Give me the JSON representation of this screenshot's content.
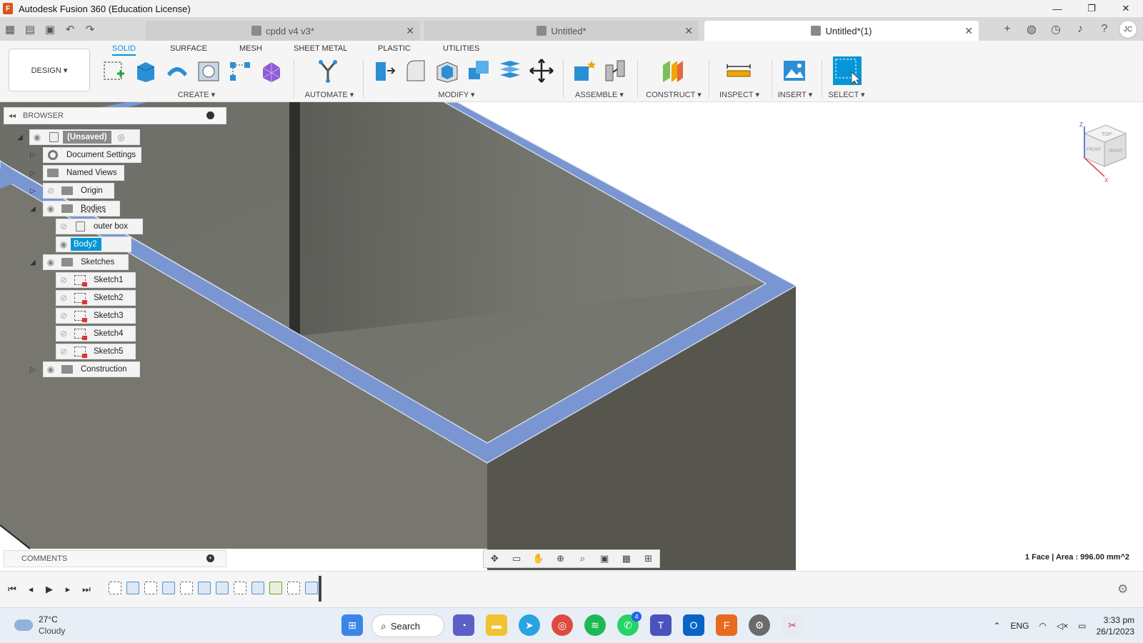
{
  "window": {
    "title": "Autodesk Fusion 360 (Education License)",
    "minimize": "—",
    "maximize": "❐",
    "close": "✕"
  },
  "tabs": [
    {
      "label": "cpdd v4 v3*",
      "active": false
    },
    {
      "label": "Untitled*",
      "active": false
    },
    {
      "label": "Untitled*(1)",
      "active": true
    }
  ],
  "user_initials": "JC",
  "workspace": {
    "design_label": "DESIGN ▾",
    "tabs": [
      "SOLID",
      "SURFACE",
      "MESH",
      "SHEET METAL",
      "PLASTIC",
      "UTILITIES"
    ],
    "active_tab": "SOLID"
  },
  "ribbon_groups": {
    "create": "CREATE ▾",
    "automate": "AUTOMATE ▾",
    "modify": "MODIFY ▾",
    "assemble": "ASSEMBLE ▾",
    "construct": "CONSTRUCT ▾",
    "inspect": "INSPECT ▾",
    "insert": "INSERT ▾",
    "select": "SELECT ▾"
  },
  "browser": {
    "title": "BROWSER",
    "root": "(Unsaved)",
    "items": {
      "document_settings": "Document Settings",
      "named_views": "Named Views",
      "origin": "Origin",
      "bodies": "Bodies",
      "outer_box": "outer box",
      "body2": "Body2",
      "sketches": "Sketches",
      "sketch1": "Sketch1",
      "sketch2": "Sketch2",
      "sketch3": "Sketch3",
      "sketch4": "Sketch4",
      "sketch5": "Sketch5",
      "construction": "Construction"
    }
  },
  "comments": {
    "title": "COMMENTS"
  },
  "status": "1 Face | Area : 996.00 mm^2",
  "viewcube": {
    "top": "TOP",
    "front": "FRONT",
    "right": "RIGHT",
    "axis_z": "Z",
    "axis_x": "X"
  },
  "taskbar": {
    "temperature": "27°C",
    "condition": "Cloudy",
    "search_label": "Search",
    "whatsapp_badge": "4",
    "language": "ENG",
    "time": "3:33 pm",
    "date": "26/1/2023"
  },
  "colors": {
    "accent": "#0696d7",
    "face_highlight": "#7a96d2",
    "body_gray": "#6f6f6a"
  }
}
